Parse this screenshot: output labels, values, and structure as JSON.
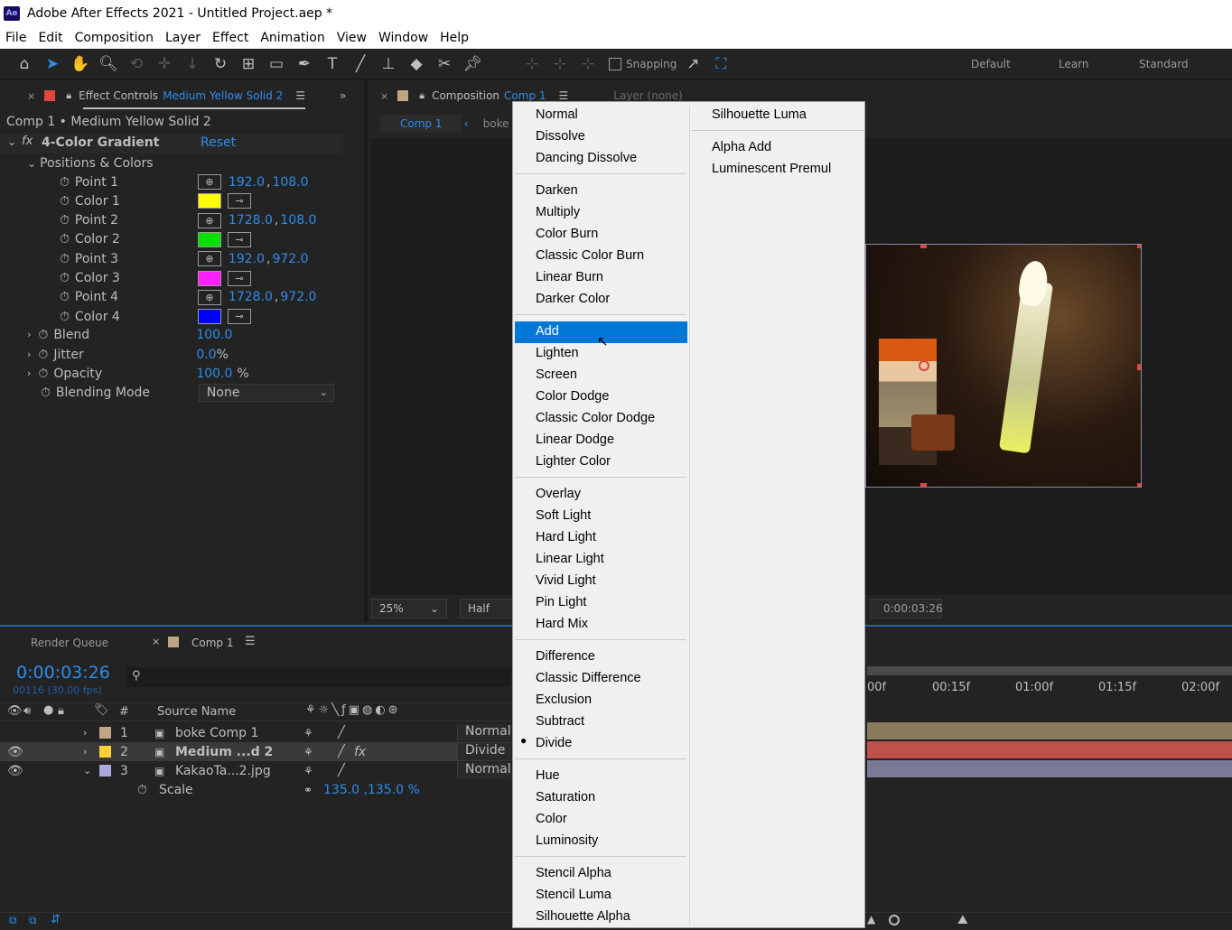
{
  "app": {
    "title": "Adobe After Effects 2021 - Untitled Project.aep *",
    "logo": "Ae"
  },
  "menubar": [
    "File",
    "Edit",
    "Composition",
    "Layer",
    "Effect",
    "Animation",
    "View",
    "Window",
    "Help"
  ],
  "toolbar": {
    "snapping_label": "Snapping",
    "workspaces": [
      "Default",
      "Learn",
      "Standard"
    ]
  },
  "effect_controls": {
    "tab_label": "Effect Controls",
    "tab_layer": "Medium Yellow Solid 2",
    "breadcrumb": "Comp 1 • Medium Yellow Solid 2",
    "effect_name": "4-Color Gradient",
    "reset": "Reset",
    "group": "Positions & Colors",
    "props": [
      {
        "label": "Point 1",
        "x": "192.0",
        "y": "108.0"
      },
      {
        "label": "Color 1",
        "color": "#ffff00"
      },
      {
        "label": "Point 2",
        "x": "1728.0",
        "y": "108.0"
      },
      {
        "label": "Color 2",
        "color": "#00e000"
      },
      {
        "label": "Point 3",
        "x": "192.0",
        "y": "972.0"
      },
      {
        "label": "Color 3",
        "color": "#ff20ff"
      },
      {
        "label": "Point 4",
        "x": "1728.0",
        "y": "972.0"
      },
      {
        "label": "Color 4",
        "color": "#0000ff"
      }
    ],
    "blend": {
      "label": "Blend",
      "value": "100.0"
    },
    "jitter": {
      "label": "Jitter",
      "value": "0.0",
      "unit": "%"
    },
    "opacity": {
      "label": "Opacity",
      "value": "100.0",
      "unit": "%"
    },
    "blending_mode": {
      "label": "Blending Mode",
      "value": "None"
    }
  },
  "composition": {
    "tab_label": "Composition",
    "tab_comp": "Comp 1",
    "layer_label": "Layer (none)",
    "subtabs": [
      "Comp 1",
      "boke C"
    ],
    "zoom": "25%",
    "resolution": "Half",
    "timecode": "0:00:03:26"
  },
  "timeline": {
    "render_queue": "Render Queue",
    "comp_tab": "Comp 1",
    "time": "0:00:03:26",
    "frames": "00116 (30.00 fps)",
    "header": {
      "hash": "#",
      "source": "Source Name"
    },
    "layers": [
      {
        "num": "1",
        "name": "boke Comp 1",
        "mode": "Normal",
        "color": "#c0a585"
      },
      {
        "num": "2",
        "name": "Medium ...d 2",
        "mode": "Divide",
        "color": "#ffd23a"
      },
      {
        "num": "3",
        "name": "KakaoTa...2.jpg",
        "mode": "Normal",
        "color": "#a9a9e0"
      }
    ],
    "scale": {
      "label": "Scale",
      "value": "135.0 ,135.0 %"
    },
    "ruler": [
      "00f",
      "00:15f",
      "01:00f",
      "01:15f",
      "02:00f"
    ]
  },
  "blend_menu": {
    "col1": [
      [
        "Normal",
        "Dissolve",
        "Dancing Dissolve"
      ],
      [
        "Darken",
        "Multiply",
        "Color Burn",
        "Classic Color Burn",
        "Linear Burn",
        "Darker Color"
      ],
      [
        "Add",
        "Lighten",
        "Screen",
        "Color Dodge",
        "Classic Color Dodge",
        "Linear Dodge",
        "Lighter Color"
      ],
      [
        "Overlay",
        "Soft Light",
        "Hard Light",
        "Linear Light",
        "Vivid Light",
        "Pin Light",
        "Hard Mix"
      ],
      [
        "Difference",
        "Classic Difference",
        "Exclusion",
        "Subtract",
        "Divide"
      ],
      [
        "Hue",
        "Saturation",
        "Color",
        "Luminosity"
      ],
      [
        "Stencil Alpha",
        "Stencil Luma",
        "Silhouette Alpha"
      ]
    ],
    "col2": [
      [
        "Silhouette Luma"
      ],
      [
        "Alpha Add",
        "Luminescent Premul"
      ]
    ],
    "highlighted": "Add",
    "checked": "Divide"
  }
}
